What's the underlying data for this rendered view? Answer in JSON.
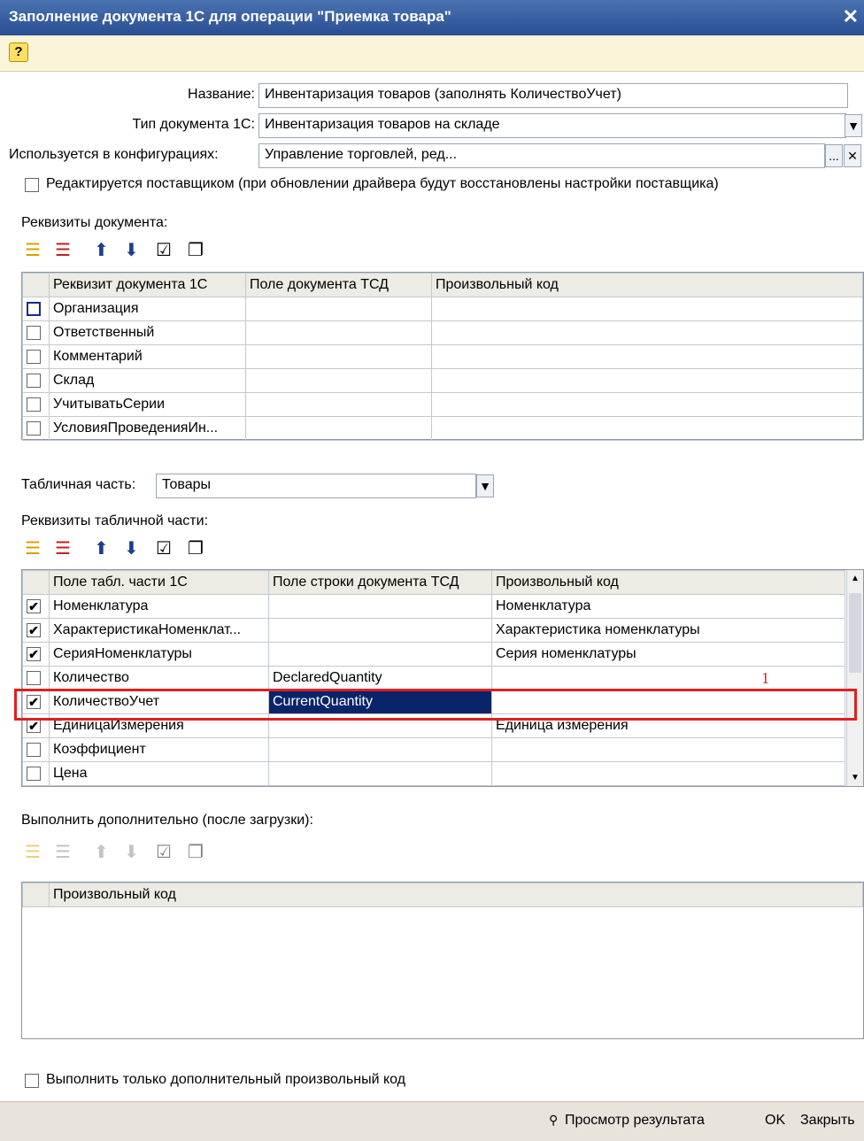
{
  "window": {
    "title": "Заполнение документа 1С для операции \"Приемка товара\"",
    "close": "✕"
  },
  "help": {
    "label": "?"
  },
  "form": {
    "name_label": "Название:",
    "name_value": "Инвентаризация товаров (заполнять КоличествоУчет)",
    "doctype_label": "Тип документа 1С:",
    "doctype_value": "Инвентаризация товаров на складе",
    "config_label": "Используется в конфигурациях:",
    "config_value": "Управление торговлей, ред...",
    "vendor_label": "Редактируется поставщиком (при обновлении драйвера будут восстановлены настройки поставщика)",
    "doc_attrs_label": "Реквизиты документа:",
    "tabpart_label": "Табличная часть:",
    "tabpart_value": "Товары",
    "tab_attrs_label": "Реквизиты табличной части:",
    "extra_label": "Выполнить дополнительно (после загрузки):",
    "only_extra_label": "Выполнить только дополнительный произвольный код"
  },
  "doc_table": {
    "headers": [
      "Реквизит документа 1С",
      "Поле документа ТСД",
      "Произвольный код"
    ],
    "rows": [
      "Организация",
      "Ответственный",
      "Комментарий",
      "Склад",
      "УчитыватьСерии",
      "УсловияПроведенияИн..."
    ]
  },
  "tab_table": {
    "headers": [
      "Поле табл. части 1С",
      "Поле строки документа ТСД",
      "Произвольный код"
    ],
    "rows": [
      {
        "checked": true,
        "field": "Номенклатура",
        "tsd": "",
        "code": "Номенклатура"
      },
      {
        "checked": true,
        "field": "ХарактеристикаНоменклат...",
        "tsd": "",
        "code": "Характеристика номенклатуры"
      },
      {
        "checked": true,
        "field": "СерияНоменклатуры",
        "tsd": "",
        "code": "Серия номенклатуры"
      },
      {
        "checked": false,
        "field": "Количество",
        "tsd": "DeclaredQuantity",
        "code": ""
      },
      {
        "checked": true,
        "field": "КоличествоУчет",
        "tsd": "CurrentQuantity",
        "code": ""
      },
      {
        "checked": true,
        "field": "ЕдиницаИзмерения",
        "tsd": "",
        "code": "Единица измерения"
      },
      {
        "checked": false,
        "field": "Коэффициент",
        "tsd": "",
        "code": ""
      },
      {
        "checked": false,
        "field": "Цена",
        "tsd": "",
        "code": ""
      }
    ],
    "annotation": "1"
  },
  "extra_table": {
    "header": "Произвольный код"
  },
  "footer": {
    "preview": "Просмотр результата",
    "ok": "OK",
    "close": "Закрыть"
  },
  "icons": {
    "check": "✔",
    "dropdown": "▼",
    "ellipsis": "...",
    "clear": "✕",
    "search": "🔍"
  }
}
